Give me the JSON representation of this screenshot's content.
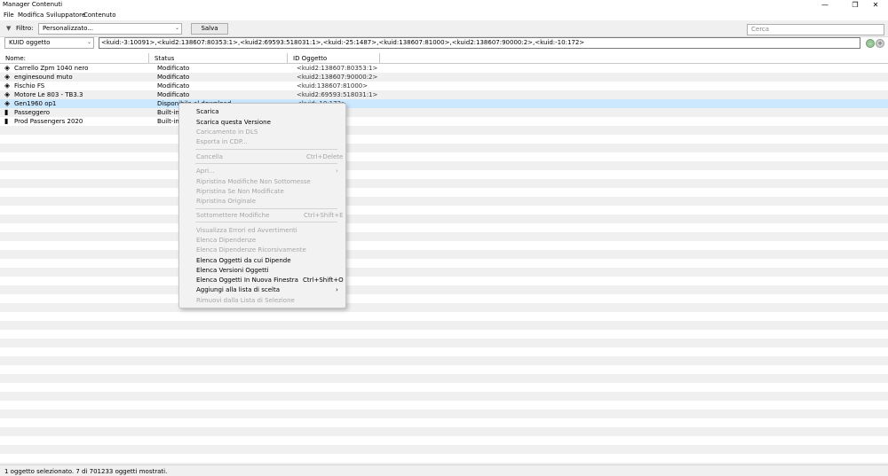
{
  "window": {
    "title": "Manager Contenuti",
    "controls": [
      {
        "name": "minimize-icon",
        "glyph": "—"
      },
      {
        "name": "maximize-icon",
        "glyph": "❐"
      },
      {
        "name": "close-icon",
        "glyph": "✕"
      }
    ]
  },
  "menu": [
    "File",
    "Modifica",
    "Sviluppatore",
    "Contenuto"
  ],
  "filter": {
    "label": "Filtro:",
    "funnel_icon": "▼",
    "value": "Personalizzato...",
    "save_label": "Salva",
    "search_placeholder": "Cerca"
  },
  "kuid_bar": {
    "type_value": "KUID oggetto",
    "kuid_text": "<kuid:-3:10091>,<kuid2:138607:80353:1>,<kuid2:69593:518031:1>,<kuid:-25:1487>,<kuid:138607:81000>,<kuid2:138607:90000:2>,<kuid:-10:172>",
    "go_glyph": "–",
    "add_glyph": "+"
  },
  "columns": [
    "Nome:",
    "Status",
    "ID Oggetto"
  ],
  "rows": [
    {
      "icon": "◈",
      "name": "Carrello Zpm 1040 nero",
      "status": "Modificato",
      "kuid": "<kuid2:138607:80353:1>"
    },
    {
      "icon": "◈",
      "name": "enginesound muto",
      "status": "Modificato",
      "kuid": "<kuid2:138607:90000:2>"
    },
    {
      "icon": "◈",
      "name": "Fischio FS",
      "status": "Modificato",
      "kuid": "<kuid:138607:81000>"
    },
    {
      "icon": "◈",
      "name": "Motore Le 803 - TB3.3",
      "status": "Modificato",
      "kuid": "<kuid2:69593:518031:1>"
    },
    {
      "icon": "◈",
      "name": "Gen1960 op1",
      "status": "Disponibile al download",
      "kuid": "<kuid:-10:172>"
    },
    {
      "icon": "▮",
      "name": "Passeggero",
      "status": "Built-in",
      "kuid": ""
    },
    {
      "icon": "▮",
      "name": "Prod Passengers 2020",
      "status": "Built-in",
      "kuid": ""
    }
  ],
  "context_menu": [
    {
      "label": "Scarica",
      "enabled": true
    },
    {
      "label": "Scarica questa Versione",
      "enabled": true
    },
    {
      "label": "Caricamento in DLS",
      "enabled": false
    },
    {
      "label": "Esporta in CDP...",
      "enabled": false
    },
    {
      "separator": true
    },
    {
      "label": "Cancella",
      "enabled": false,
      "shortcut": "Ctrl+Delete"
    },
    {
      "separator": true
    },
    {
      "label": "Apri...",
      "enabled": false,
      "submenu": true
    },
    {
      "label": "Ripristina Modifiche Non Sottomesse",
      "enabled": false
    },
    {
      "label": "Ripristina Se Non Modificate",
      "enabled": false
    },
    {
      "label": "Ripristina Originale",
      "enabled": false
    },
    {
      "separator": true
    },
    {
      "label": "Sottomettere Modifiche",
      "enabled": false,
      "shortcut": "Ctrl+Shift+E"
    },
    {
      "separator": true
    },
    {
      "label": "Visualizza Errori ed Avvertimenti",
      "enabled": false
    },
    {
      "label": "Elenca Dipendenze",
      "enabled": false
    },
    {
      "label": "Elenca Dipendenze Ricorsivamente",
      "enabled": false
    },
    {
      "label": "Elenca Oggetti da cui Dipende",
      "enabled": true
    },
    {
      "label": "Elenca Versioni Oggetti",
      "enabled": true
    },
    {
      "label": "Elenca Oggetti In Nuova Finestra",
      "enabled": true,
      "shortcut": "Ctrl+Shift+O"
    },
    {
      "label": "Aggiungi alla lista di scelta",
      "enabled": true,
      "submenu": true
    },
    {
      "label": "Rimuovi dalla Lista di Selezione",
      "enabled": false
    }
  ],
  "status_bar": "1 oggetto selezionato. 7 di 701233 oggetti mostrati.",
  "colors": {
    "selection": "#cce8ff",
    "stripe": "#f0f0f0",
    "chrome": "#f0f0f0"
  }
}
